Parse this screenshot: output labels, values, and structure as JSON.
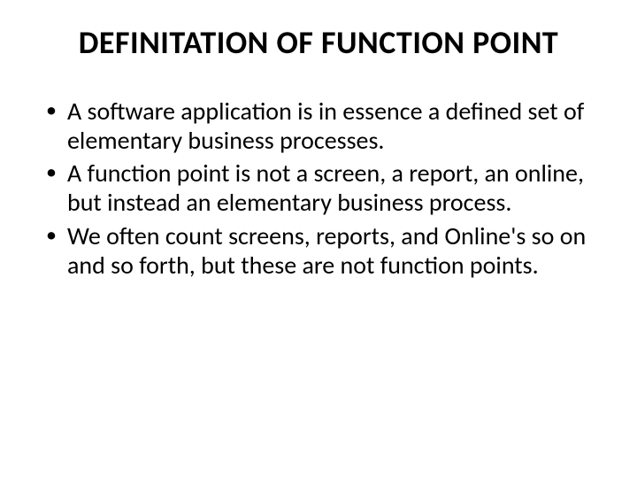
{
  "slide": {
    "title": "DEFINITATION OF FUNCTION POINT",
    "bullets": [
      "A software application is in essence a defined set of elementary business processes.",
      " A function point is not a screen, a report, an online, but instead an elementary business process.",
      "We often count screens, reports, and Online's so on and so forth, but these are not function points."
    ]
  }
}
